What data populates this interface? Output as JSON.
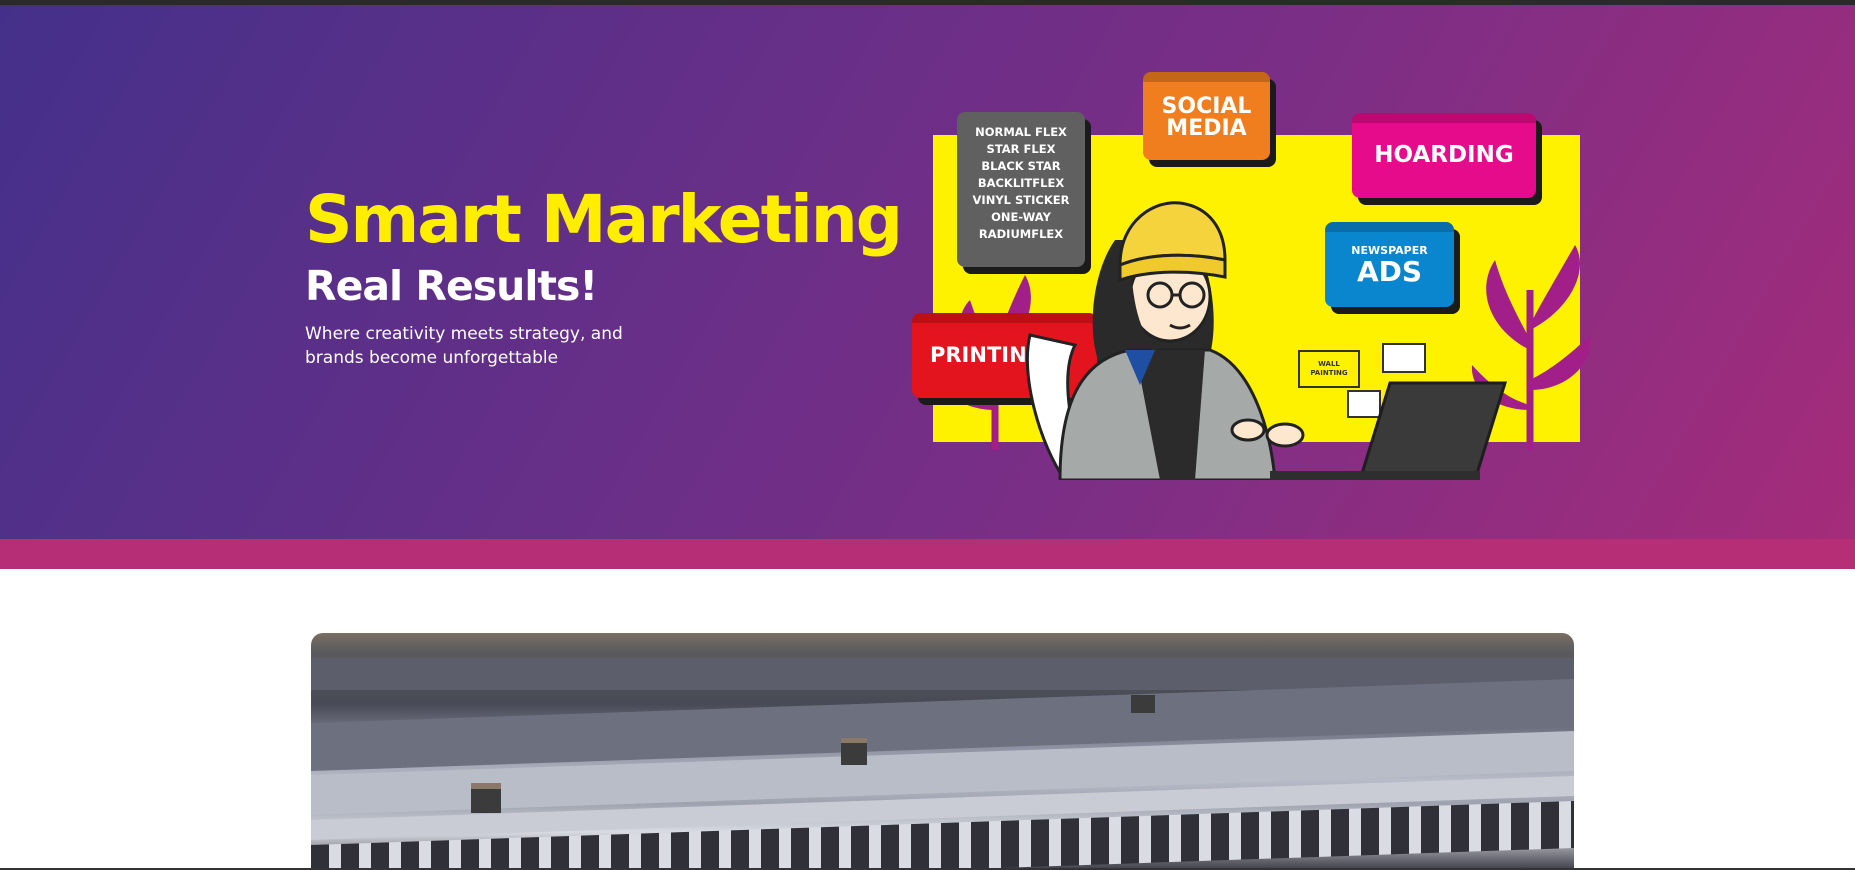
{
  "hero": {
    "title": "Smart Marketing",
    "subtitle": "Real Results!",
    "description": "Where creativity meets strategy, and brands become unforgettable"
  },
  "illustration": {
    "flex_card_lines": [
      "NORMAL FLEX",
      "STAR FLEX",
      "BLACK STAR",
      "BACKLITFLEX",
      "VINYL STICKER",
      "ONE-WAY",
      "RADIUMFLEX"
    ],
    "social_media": "SOCIAL MEDIA",
    "hoarding": "HOARDING",
    "newspaper": "NEWSPAPER",
    "ads": "ADS",
    "printing": "PRINTIN",
    "wall_painting": "WALL PAINTING"
  },
  "colors": {
    "title_yellow": "#ffee00",
    "hero_gradient_start": "#44308a",
    "hero_gradient_end": "#a52c7a",
    "accent_strip": "#b62e76"
  }
}
